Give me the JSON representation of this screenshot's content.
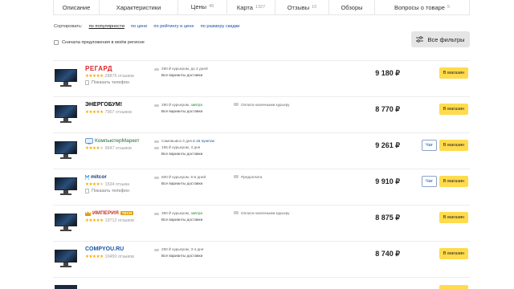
{
  "tabs": [
    {
      "label": "Описание",
      "count": ""
    },
    {
      "label": "Характеристики",
      "count": ""
    },
    {
      "label": "Цены",
      "count": "49"
    },
    {
      "label": "Карта",
      "count": "1327"
    },
    {
      "label": "Отзывы",
      "count": "10"
    },
    {
      "label": "Обзоры",
      "count": ""
    },
    {
      "label": "Вопросы о товаре",
      "count": "5"
    }
  ],
  "sort": {
    "label": "Сортировать:",
    "options": [
      "по популярности",
      "по цене",
      "по рейтингу и цене",
      "по размеру скидки"
    ],
    "active_index": 0
  },
  "region_filter": {
    "label": "Сначала предложения в моём регионе",
    "checked": false
  },
  "filters_button": {
    "label": "Все фильтры",
    "icon": "sliders-icon"
  },
  "colors": {
    "buy_button": "#ffdb4d",
    "star": "#f7a900",
    "link": "#1a4fa0",
    "green": "#1e8a2e"
  },
  "offers": [
    {
      "shop": "РЕГАРД",
      "rating": 5,
      "reviews": "28875 отзывов",
      "phone": "Показать телефон",
      "delivery": [
        {
          "text": "290 ₽ курьером, до 4 дней",
          "highlight": ""
        }
      ],
      "delivery_all": "Все варианты доставки",
      "extra": "",
      "price": "9 180 ₽",
      "chat": "",
      "buy": "В магазин"
    },
    {
      "shop": "ЭНЕРГОБУМ!",
      "rating": 5,
      "reviews": "7907 отзывов",
      "phone": "",
      "delivery": [
        {
          "text": "290 ₽ курьером, ",
          "highlight": "завтра"
        }
      ],
      "delivery_all": "Все варианты доставки",
      "extra": "Оплата наличными курьеру",
      "price": "8 770 ₽",
      "chat": "",
      "buy": "В магазин"
    },
    {
      "shop": "КомпьютерМаркет",
      "rating": 4,
      "reviews": "9647 отзывов",
      "phone": "",
      "delivery": [
        {
          "text": "Самовывоз 3 дня ",
          "highlight": "в 15 пунктах"
        },
        {
          "text": "195 ₽ курьером, 3 дня",
          "highlight": ""
        }
      ],
      "delivery_all": "Все варианты доставки",
      "extra": "",
      "price": "9 261 ₽",
      "chat": "Чат",
      "buy": "В магазин"
    },
    {
      "shop": "mitcor",
      "rating": 4,
      "reviews": "1534 отзыва",
      "phone": "Показать телефон",
      "delivery": [
        {
          "text": "600 ₽ курьером, 5-6 дней",
          "highlight": ""
        }
      ],
      "delivery_all": "Все варианты доставки",
      "extra": "Предоплата",
      "price": "9 910 ₽",
      "chat": "Чат",
      "buy": "В магазин"
    },
    {
      "shop": "ИМПЕРИЯ",
      "shop_badge": "TECH",
      "rating": 5,
      "reviews": "19712 отзывов",
      "phone": "",
      "delivery": [
        {
          "text": "390 ₽ курьером, ",
          "highlight": "завтра"
        }
      ],
      "delivery_all": "Все варианты доставки",
      "extra": "Оплата наличными курьеру",
      "price": "8 875 ₽",
      "chat": "",
      "buy": "В магазин"
    },
    {
      "shop": "COMPYOU.RU",
      "rating": 5,
      "reviews": "10450 отзывов",
      "phone": "",
      "delivery": [
        {
          "text": "290 ₽ курьером, 3-4 дня",
          "highlight": ""
        }
      ],
      "delivery_all": "Все варианты доставки",
      "extra": "",
      "price": "8 740 ₽",
      "chat": "",
      "buy": "В магазин"
    }
  ]
}
